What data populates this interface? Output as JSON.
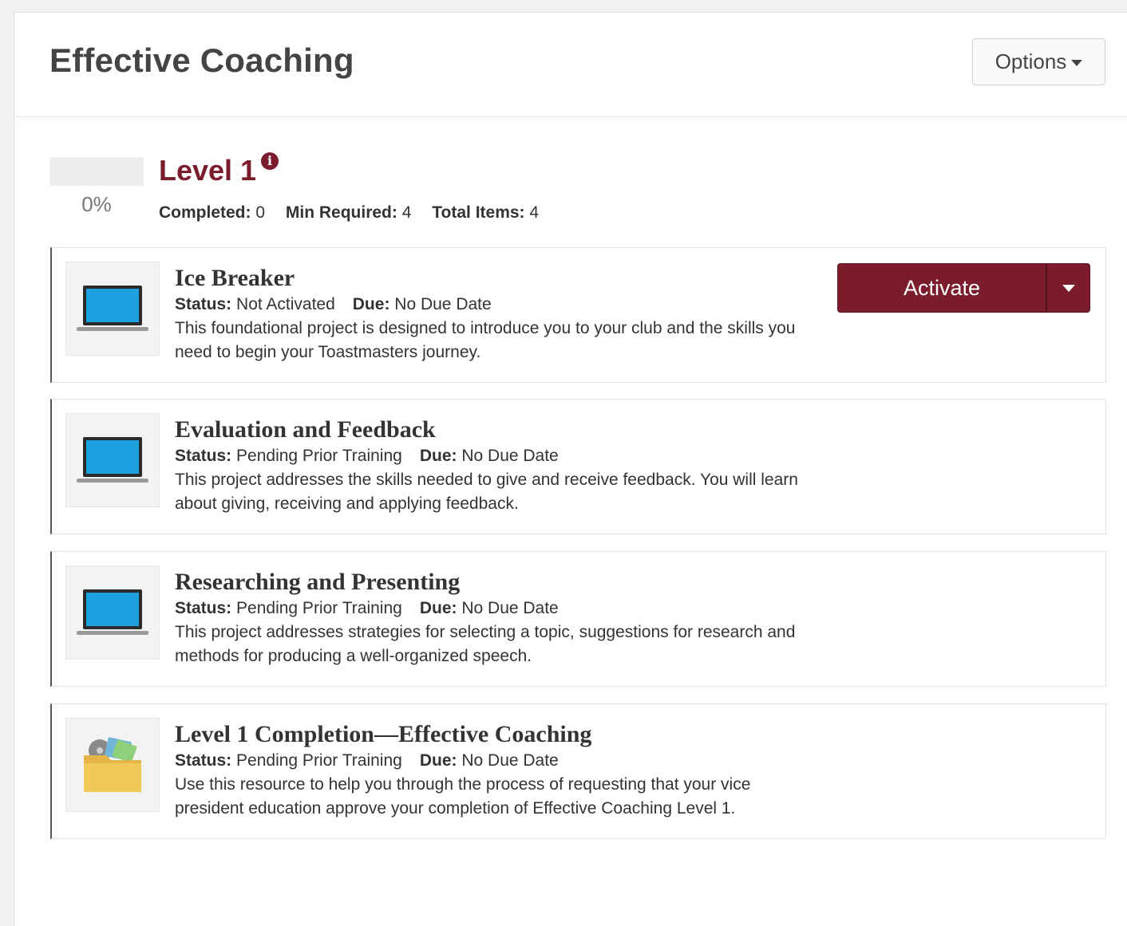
{
  "header": {
    "title": "Effective Coaching",
    "options_label": "Options"
  },
  "level": {
    "title": "Level 1",
    "progress_label": "0%",
    "progress_fraction": 0,
    "stats": {
      "completed_label": "Completed:",
      "completed_value": "0",
      "min_required_label": "Min Required:",
      "min_required_value": "4",
      "total_items_label": "Total Items:",
      "total_items_value": "4"
    }
  },
  "labels": {
    "status": "Status:",
    "due": "Due:"
  },
  "items": [
    {
      "title": "Ice Breaker",
      "status": "Not Activated",
      "due": "No Due Date",
      "description": "This foundational project is designed to introduce you to your club and the skills you need to begin your Toastmasters journey.",
      "icon": "laptop-icon"
    },
    {
      "title": "Evaluation and Feedback",
      "status": "Pending Prior Training",
      "due": "No Due Date",
      "description": "This project addresses the skills needed to give and receive feedback. You will learn about giving, receiving and applying feedback.",
      "icon": "laptop-icon"
    },
    {
      "title": "Researching and Presenting",
      "status": "Pending Prior Training",
      "due": "No Due Date",
      "description": "This project addresses strategies for selecting a topic, suggestions for research and methods for producing a well-organized speech.",
      "icon": "laptop-icon"
    },
    {
      "title": "Level 1 Completion—Effective Coaching",
      "status": "Pending Prior Training",
      "due": "No Due Date",
      "description": "Use this resource to help you through the process of requesting that your vice president education approve your completion of Effective Coaching Level 1.",
      "icon": "folder-icon"
    }
  ],
  "actions": {
    "activate_label": "Activate"
  },
  "colors": {
    "brand": "#7a1c2b",
    "laptop_screen": "#1da1e0",
    "folder": "#f0c95a"
  }
}
